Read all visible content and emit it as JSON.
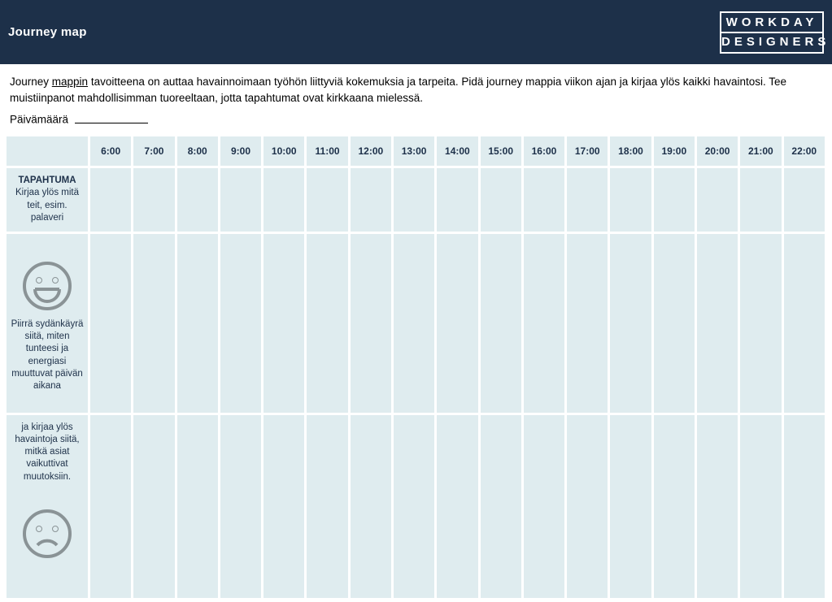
{
  "header": {
    "title": "Journey map",
    "logo_line1": "WORKDAY",
    "logo_line2": "DESIGNERS"
  },
  "intro": {
    "text_prefix": "Journey ",
    "link_word": "mappin",
    "text_suffix": " tavoitteena on auttaa havainnoimaan työhön liittyviä kokemuksia ja tarpeita. Pidä journey mappia viikon ajan ja kirjaa ylös kaikki havaintosi. Tee muistiinpanot mahdollisimman tuoreeltaan, jotta tapahtumat ovat kirkkaana mielessä."
  },
  "date_label": "Päivämäärä",
  "hours": [
    "6:00",
    "7:00",
    "8:00",
    "9:00",
    "10:00",
    "11:00",
    "12:00",
    "13:00",
    "14:00",
    "15:00",
    "16:00",
    "17:00",
    "18:00",
    "19:00",
    "20:00",
    "21:00",
    "22:00"
  ],
  "rows": {
    "event": {
      "title": "TAPAHTUMA",
      "desc": "Kirjaa ylös mitä teit, esim. palaveri"
    },
    "mood": {
      "desc": "Piirrä sydänkäyrä siitä, miten tunteesi ja energiasi muuttuvat päivän aikana"
    },
    "observe": {
      "desc": "ja kirjaa ylös havaintoja siitä, mitkä asiat vaikuttivat muutoksiin."
    }
  }
}
